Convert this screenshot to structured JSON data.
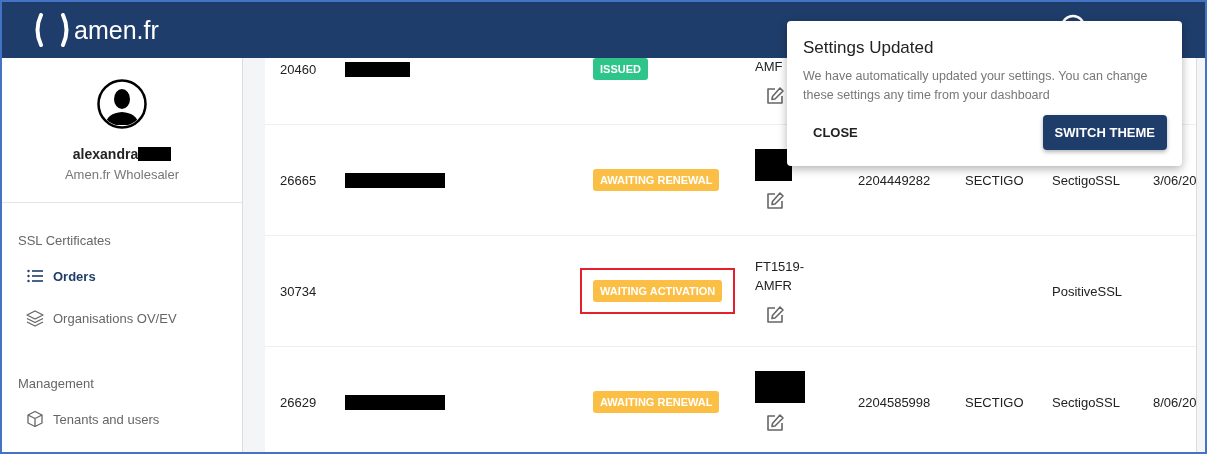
{
  "header": {
    "logo": "amen.fr"
  },
  "sidebar": {
    "user": {
      "name": "alexandra",
      "name_redacted": true,
      "role": "Amen.fr Wholesaler"
    },
    "sections": [
      {
        "title": "SSL Certificates",
        "items": [
          {
            "label": "Orders",
            "kind": "list",
            "selected": true
          },
          {
            "label": "Organisations OV/EV",
            "kind": "layers",
            "selected": false
          }
        ]
      },
      {
        "title": "Management",
        "items": [
          {
            "label": "Tenants and users",
            "kind": "cube",
            "selected": false
          }
        ]
      }
    ]
  },
  "orders": {
    "rows": [
      {
        "id": "20460",
        "name_redacted": true,
        "status": {
          "label": "ISSUED",
          "kind": "issued",
          "highlighted": false
        },
        "reference": "AMF",
        "reference_redacted": false
      },
      {
        "id": "26665",
        "name_redacted": true,
        "status": {
          "label": "AWAITING RENEWAL",
          "kind": "pending",
          "highlighted": false
        },
        "reference_redacted": true,
        "number": "2204449282",
        "ca": "SECTIGO",
        "product": "SectigoSSL",
        "date": "3/06/20"
      },
      {
        "id": "30734",
        "name_redacted": false,
        "status": {
          "label": "WAITING ACTIVATION",
          "kind": "pending",
          "highlighted": true
        },
        "reference": "FT1519- AMFR",
        "reference_redacted": false,
        "product": "PositiveSSL"
      },
      {
        "id": "26629",
        "name_redacted": true,
        "status": {
          "label": "AWAITING RENEWAL",
          "kind": "pending",
          "highlighted": false
        },
        "reference_redacted": true,
        "number": "2204585998",
        "ca": "SECTIGO",
        "product": "SectigoSSL",
        "date": "8/06/20"
      }
    ]
  },
  "dialog": {
    "title": "Settings Updated",
    "message": "We have automatically updated your settings. You can change these settings any time from your dashboard",
    "buttons": [
      {
        "label": "CLOSE",
        "kind": "text"
      },
      {
        "label": "SWITCH THEME",
        "kind": "primary"
      }
    ]
  }
}
